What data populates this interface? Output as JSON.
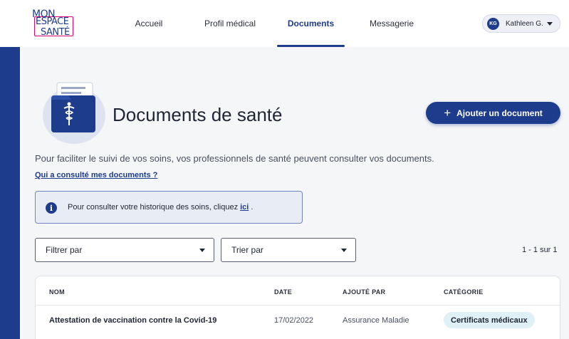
{
  "header": {
    "logo": {
      "line1": "MON",
      "line2": "ESPACE",
      "line3": "SANTÉ"
    },
    "nav": [
      {
        "label": "Accueil"
      },
      {
        "label": "Profil médical"
      },
      {
        "label": "Documents",
        "active": true
      },
      {
        "label": "Messagerie"
      }
    ],
    "user": {
      "initials": "KG",
      "name": "Kathleen G."
    }
  },
  "page": {
    "title": "Documents de santé",
    "add_button": "Ajouter un document",
    "add_icon": "plus-icon",
    "intro": "Pour faciliter le suivi de vos soins, vos professionnels de santé peuvent consulter vos documents.",
    "consult_link": "Qui a consulté mes documents ?",
    "info": {
      "icon": "info-icon",
      "text_before": "Pour consulter votre historique des soins, cliquez ",
      "link": "ici",
      "text_after": " ."
    },
    "filter": {
      "label": "Filtrer par"
    },
    "sort": {
      "label": "Trier par"
    },
    "count": "1 - 1 sur 1"
  },
  "table": {
    "headers": [
      "NOM",
      "DATE",
      "AJOUTÉ PAR",
      "CATÉGORIE"
    ],
    "rows": [
      {
        "name": "Attestation de vaccination contre la Covid-19",
        "date": "17/02/2022",
        "added_by": "Assurance Maladie",
        "category": "Certificats médicaux"
      }
    ]
  },
  "colors": {
    "primary": "#1e3c8c",
    "logo_accent": "#e4007c",
    "badge_bg": "#dff0f7",
    "info_bg": "#e8ecf5"
  }
}
